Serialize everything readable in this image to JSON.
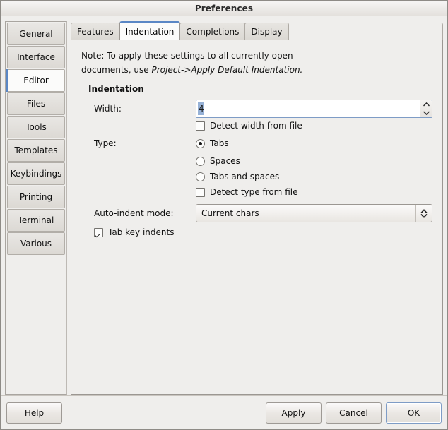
{
  "window": {
    "title": "Preferences"
  },
  "sidebar": {
    "items": [
      {
        "label": "General",
        "selected": false
      },
      {
        "label": "Interface",
        "selected": false
      },
      {
        "label": "Editor",
        "selected": true
      },
      {
        "label": "Files",
        "selected": false
      },
      {
        "label": "Tools",
        "selected": false
      },
      {
        "label": "Templates",
        "selected": false
      },
      {
        "label": "Keybindings",
        "selected": false
      },
      {
        "label": "Printing",
        "selected": false
      },
      {
        "label": "Terminal",
        "selected": false
      },
      {
        "label": "Various",
        "selected": false
      }
    ]
  },
  "tabs": [
    {
      "label": "Features",
      "active": false
    },
    {
      "label": "Indentation",
      "active": true
    },
    {
      "label": "Completions",
      "active": false
    },
    {
      "label": "Display",
      "active": false
    }
  ],
  "panel": {
    "note": {
      "line1": "Note: To apply these settings to all currently open",
      "line2_prefix": "documents, use ",
      "line2_italic": "Project->Apply Default Indentation."
    },
    "section_title": "Indentation",
    "width": {
      "label": "Width:",
      "value": "4",
      "selected": true
    },
    "detect_width": {
      "label": "Detect width from file",
      "checked": false
    },
    "type": {
      "label": "Type:",
      "options": [
        {
          "label": "Tabs",
          "checked": true
        },
        {
          "label": "Spaces",
          "checked": false
        },
        {
          "label": "Tabs and spaces",
          "checked": false
        }
      ]
    },
    "detect_type": {
      "label": "Detect type from file",
      "checked": false
    },
    "auto_indent": {
      "label": "Auto-indent mode:",
      "value": "Current chars"
    },
    "tab_key_indents": {
      "label": "Tab key indents",
      "checked": true
    }
  },
  "footer": {
    "help": "Help",
    "apply": "Apply",
    "cancel": "Cancel",
    "ok": "OK"
  },
  "colors": {
    "accent": "#5a87c5",
    "selection": "#96b1d6",
    "window_bg": "#efeeec",
    "panel_bg": "#efeeec",
    "entry_bg": "#ffffff"
  }
}
